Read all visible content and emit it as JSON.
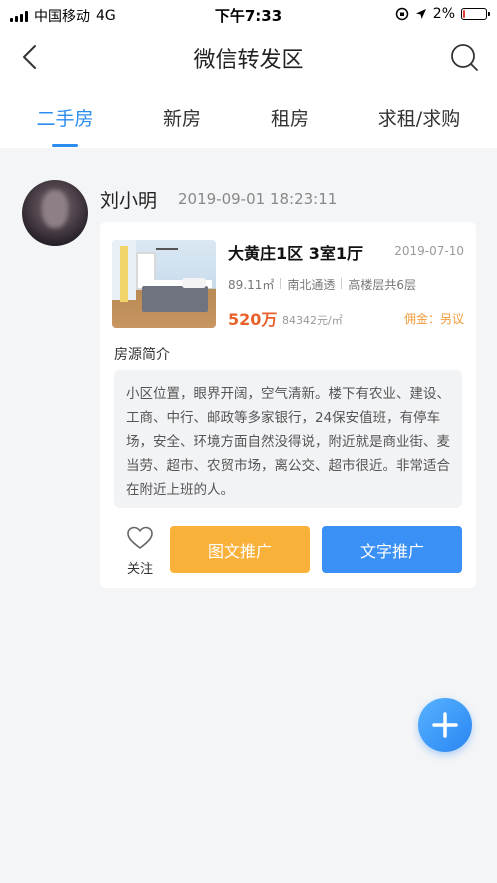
{
  "status_bar": {
    "carrier": "中国移动",
    "network": "4G",
    "time": "下午7:33",
    "battery_text": "2%",
    "battery_level": 0.02,
    "battery_color": "#e53935"
  },
  "nav": {
    "title": "微信转发区",
    "back_icon": "chevron-left-icon",
    "search_icon": "search-icon"
  },
  "tabs": [
    {
      "label": "二手房",
      "active": true
    },
    {
      "label": "新房",
      "active": false
    },
    {
      "label": "租房",
      "active": false
    },
    {
      "label": "求租/求购",
      "active": false
    }
  ],
  "post": {
    "username": "刘小明",
    "time": "2019-09-01 18:23:11",
    "listing": {
      "title": "大黄庄1区 3室1厅",
      "date": "2019-07-10",
      "area": "89.11㎡",
      "orientation": "南北通透",
      "floor": "高楼层共6层",
      "price": "520万",
      "unit_price": "84342元/㎡",
      "commission": "佣金：另议"
    },
    "intro_title": "房源简介",
    "intro_text": "小区位置，眼界开阔，空气清新。楼下有农业、建设、工商、中行、邮政等多家银行，24保安值班，有停车场，安全、环境方面自然没得说，附近就是商业街、麦当劳、超市、农贸市场，离公交、超市很近。非常适合在附近上班的人。",
    "follow_label": "关注",
    "promo_image_label": "图文推广",
    "promo_text_label": "文字推广"
  },
  "colors": {
    "accent": "#2b8cf0",
    "price": "#e8612c",
    "commission": "#f39a3a",
    "promo_image": "#f9b13a",
    "promo_text": "#3b90f5"
  },
  "fab_icon": "plus-icon"
}
